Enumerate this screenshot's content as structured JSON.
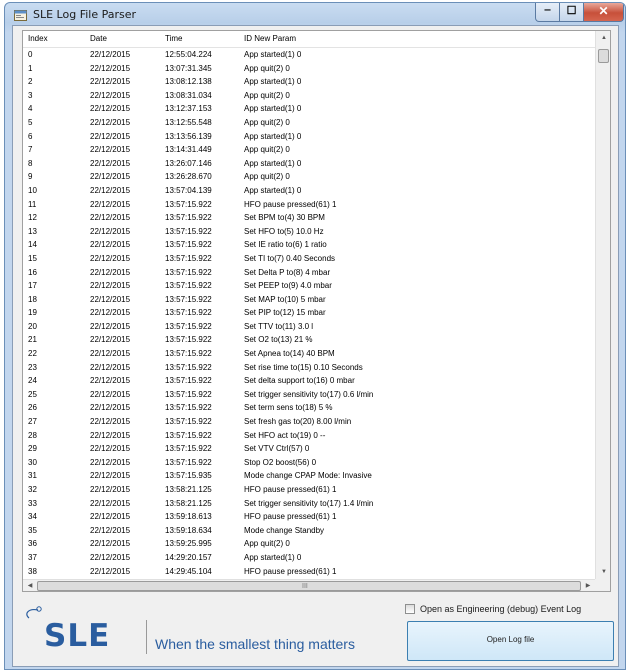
{
  "window": {
    "title": "SLE Log File Parser",
    "controls": {
      "minimize": "‒",
      "maximize": "☐",
      "close": "✕"
    }
  },
  "grid": {
    "columns": [
      "Index",
      "Date",
      "Time",
      "ID New Param"
    ],
    "rows": [
      [
        "0",
        "22/12/2015",
        "12:55:04.224",
        "App started(1) 0"
      ],
      [
        "1",
        "22/12/2015",
        "13:07:31.345",
        "App quit(2) 0"
      ],
      [
        "2",
        "22/12/2015",
        "13:08:12.138",
        "App started(1) 0"
      ],
      [
        "3",
        "22/12/2015",
        "13:08:31.034",
        "App quit(2) 0"
      ],
      [
        "4",
        "22/12/2015",
        "13:12:37.153",
        "App started(1) 0"
      ],
      [
        "5",
        "22/12/2015",
        "13:12:55.548",
        "App quit(2) 0"
      ],
      [
        "6",
        "22/12/2015",
        "13:13:56.139",
        "App started(1) 0"
      ],
      [
        "7",
        "22/12/2015",
        "13:14:31.449",
        "App quit(2) 0"
      ],
      [
        "8",
        "22/12/2015",
        "13:26:07.146",
        "App started(1) 0"
      ],
      [
        "9",
        "22/12/2015",
        "13:26:28.670",
        "App quit(2) 0"
      ],
      [
        "10",
        "22/12/2015",
        "13:57:04.139",
        "App started(1) 0"
      ],
      [
        "11",
        "22/12/2015",
        "13:57:15.922",
        "HFO pause pressed(61) 1"
      ],
      [
        "12",
        "22/12/2015",
        "13:57:15.922",
        "Set BPM to(4) 30 BPM"
      ],
      [
        "13",
        "22/12/2015",
        "13:57:15.922",
        "Set HFO to(5) 10.0 Hz"
      ],
      [
        "14",
        "22/12/2015",
        "13:57:15.922",
        "Set IE ratio to(6) 1 ratio"
      ],
      [
        "15",
        "22/12/2015",
        "13:57:15.922",
        "Set TI to(7) 0.40 Seconds"
      ],
      [
        "16",
        "22/12/2015",
        "13:57:15.922",
        "Set Delta P to(8) 4 mbar"
      ],
      [
        "17",
        "22/12/2015",
        "13:57:15.922",
        "Set PEEP to(9) 4.0 mbar"
      ],
      [
        "18",
        "22/12/2015",
        "13:57:15.922",
        "Set MAP to(10) 5 mbar"
      ],
      [
        "19",
        "22/12/2015",
        "13:57:15.922",
        "Set PIP to(12) 15 mbar"
      ],
      [
        "20",
        "22/12/2015",
        "13:57:15.922",
        "Set TTV to(11) 3.0 l"
      ],
      [
        "21",
        "22/12/2015",
        "13:57:15.922",
        "Set O2 to(13) 21 %"
      ],
      [
        "22",
        "22/12/2015",
        "13:57:15.922",
        "Set Apnea to(14) 40 BPM"
      ],
      [
        "23",
        "22/12/2015",
        "13:57:15.922",
        "Set rise time to(15) 0.10 Seconds"
      ],
      [
        "24",
        "22/12/2015",
        "13:57:15.922",
        "Set delta support to(16) 0 mbar"
      ],
      [
        "25",
        "22/12/2015",
        "13:57:15.922",
        "Set trigger sensitivity to(17) 0.6 l/min"
      ],
      [
        "26",
        "22/12/2015",
        "13:57:15.922",
        "Set term sens to(18) 5 %"
      ],
      [
        "27",
        "22/12/2015",
        "13:57:15.922",
        "Set fresh gas to(20) 8.00 l/min"
      ],
      [
        "28",
        "22/12/2015",
        "13:57:15.922",
        "Set HFO act to(19) 0 --"
      ],
      [
        "29",
        "22/12/2015",
        "13:57:15.922",
        "Set VTV Ctrl(57) 0"
      ],
      [
        "30",
        "22/12/2015",
        "13:57:15.922",
        "Stop O2 boost(56) 0"
      ],
      [
        "31",
        "22/12/2015",
        "13:57:15.935",
        "Mode change CPAP Mode: Invasive"
      ],
      [
        "32",
        "22/12/2015",
        "13:58:21.125",
        "HFO pause pressed(61) 1"
      ],
      [
        "33",
        "22/12/2015",
        "13:58:21.125",
        "Set trigger sensitivity to(17) 1.4 l/min"
      ],
      [
        "34",
        "22/12/2015",
        "13:59:18.613",
        "HFO pause pressed(61) 1"
      ],
      [
        "35",
        "22/12/2015",
        "13:59:18.634",
        "Mode change Standby"
      ],
      [
        "36",
        "22/12/2015",
        "13:59:25.995",
        "App quit(2) 0"
      ],
      [
        "37",
        "22/12/2015",
        "14:29:20.157",
        "App started(1) 0"
      ],
      [
        "38",
        "22/12/2015",
        "14:29:45.104",
        "HFO pause pressed(61) 1"
      ]
    ],
    "hscroll_grip": "III"
  },
  "footer": {
    "logo_text": "SLE",
    "tagline": "When the smallest thing matters",
    "debug_checkbox_label": "Open as Engineering (debug) Event Log",
    "debug_checked": false,
    "open_button_label": "Open Log file"
  },
  "colors": {
    "brand": "#2a5d9f",
    "button_border": "#3c7fb1",
    "close_button": "#c7503a"
  }
}
